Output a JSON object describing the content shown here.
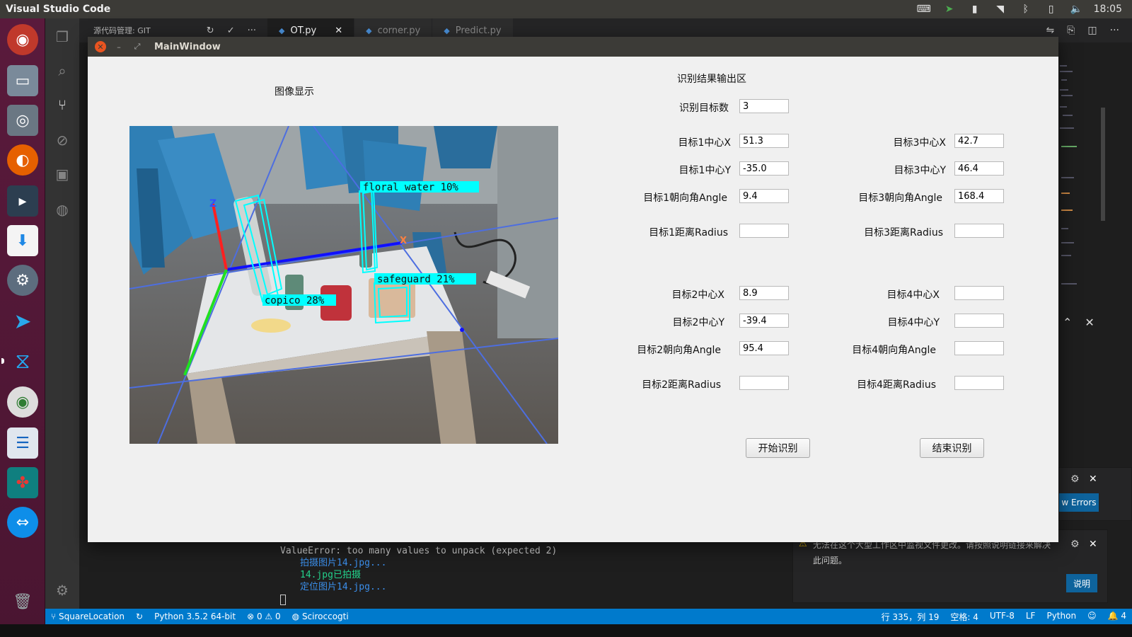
{
  "topbar": {
    "app_title": "Visual Studio Code",
    "clock": "18:05"
  },
  "vscode": {
    "sidebar_title": "源代码管理: GIT",
    "tabs": [
      {
        "label": "OT.py",
        "active": true
      },
      {
        "label": "corner.py",
        "active": false
      },
      {
        "label": "Predict.py",
        "active": false
      }
    ],
    "terminal": {
      "lines": [
        {
          "text": "ValueError: too many values to unpack (expected 2)",
          "style": "err"
        },
        {
          "text": "拍摄图片14.jpg...",
          "style": "blue"
        },
        {
          "text": "14.jpg已拍摄",
          "style": "green"
        },
        {
          "text": "定位图片14.jpg...",
          "style": "blue"
        }
      ]
    },
    "notifications": {
      "upper_button": "w Errors",
      "lower_text_line1": "无法在这个大型工作区中监视文件更改。请按照说明链接来解决",
      "lower_text_line2": "此问题。",
      "lower_button": "说明"
    },
    "statusbar": {
      "branch": "SquareLocation",
      "python": "Python 3.5.2 64-bit",
      "errors": "0",
      "warnings": "0",
      "user": "Sciroccogti",
      "position": "行 335，列 19",
      "spaces": "空格: 4",
      "encoding": "UTF-8",
      "eol": "LF",
      "language": "Python",
      "notifications_count": "4"
    }
  },
  "main_window": {
    "title": "MainWindow",
    "image_title": "图像显示",
    "result_title": "识别结果输出区",
    "count_label": "识别目标数",
    "count_value": "3",
    "targets": [
      {
        "cx_label": "目标1中心X",
        "cx": "51.3",
        "cy_label": "目标1中心Y",
        "cy": "-35.0",
        "angle_label": "目标1朝向角Angle",
        "angle": "9.4",
        "radius_label": "目标1距离Radius",
        "radius": ""
      },
      {
        "cx_label": "目标2中心X",
        "cx": "8.9",
        "cy_label": "目标2中心Y",
        "cy": "-39.4",
        "angle_label": "目标2朝向角Angle",
        "angle": "95.4",
        "radius_label": "目标2距离Radius",
        "radius": ""
      },
      {
        "cx_label": "目标3中心X",
        "cx": "42.7",
        "cy_label": "目标3中心Y",
        "cy": "46.4",
        "angle_label": "目标3朝向角Angle",
        "angle": "168.4",
        "radius_label": "目标3距离Radius",
        "radius": ""
      },
      {
        "cx_label": "目标4中心X",
        "cx": "",
        "cy_label": "目标4中心Y",
        "cy": "",
        "angle_label": "目标4朝向角Angle",
        "angle": "",
        "radius_label": "目标4距离Radius",
        "radius": ""
      }
    ],
    "start_button": "开始识别",
    "stop_button": "结束识别",
    "detections": [
      {
        "label": "floral  water  10%"
      },
      {
        "label": "safeguard  21%"
      },
      {
        "label": "copico  28%"
      }
    ],
    "axis_labels": {
      "z": "Z",
      "x": "X"
    }
  },
  "colors": {
    "accent": "#007acc",
    "launcher": "#5a1a3c",
    "detection": "#00ffff"
  }
}
